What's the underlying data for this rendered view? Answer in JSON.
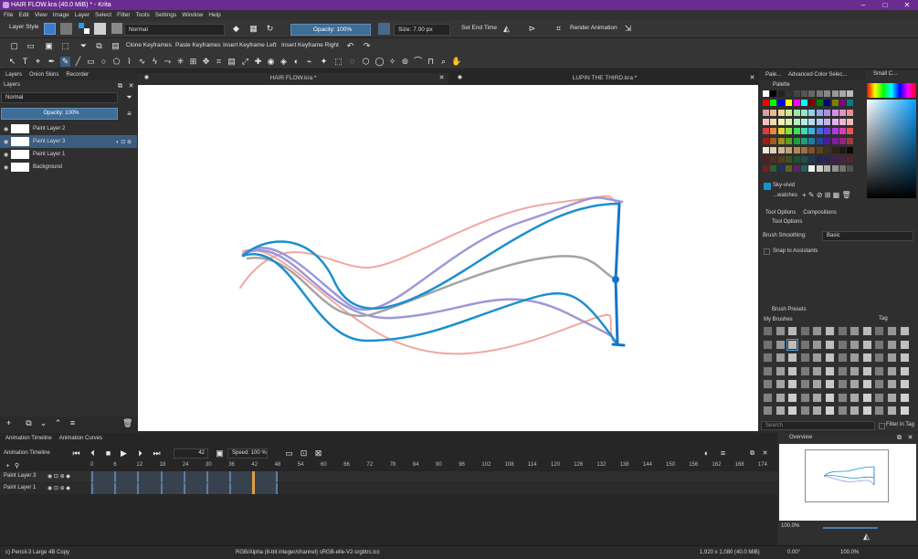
{
  "window": {
    "title": "HAIR FLOW.kra (40.0 MiB)  * - Krita",
    "minimize": "–",
    "maximize": "□",
    "close": "✕"
  },
  "menu": [
    "File",
    "Edit",
    "View",
    "Image",
    "Layer",
    "Select",
    "Filter",
    "Tools",
    "Settings",
    "Window",
    "Help"
  ],
  "toolbar": {
    "layer_style": "Layer Style",
    "blend_mode": "Normal",
    "opacity": "Opacity: 100%",
    "size": "Size: 7.00 px",
    "set_end_time": "Set End Time",
    "render_animation": "Render Animation",
    "clone_keyframes": "Clone Keyframes",
    "paste_keyframes": "Paste Keyframes",
    "insert_keyframe_left": "Insert Keyframe Left",
    "insert_keyframe_right": "Insert Keyframe Right"
  },
  "left_dock": {
    "tabs": [
      "Layers",
      "Onion Skins",
      "Recorder"
    ],
    "header": "Layers",
    "blend_mode": "Normal",
    "opacity": "Opacity:  100%",
    "layers": [
      {
        "name": "Paint Layer 2",
        "selected": false
      },
      {
        "name": "Paint Layer 3",
        "selected": true
      },
      {
        "name": "Paint Layer 1",
        "selected": false
      },
      {
        "name": "Background",
        "selected": false
      }
    ]
  },
  "documents": {
    "tabs": [
      "HAIR FLOW.kra *",
      "LUPIN THE THIRD.kra *"
    ]
  },
  "right_dock": {
    "top_tabs": [
      "Pale...",
      "Advanced Color Selec..."
    ],
    "small_color": "Small C...",
    "palette_title": "Palette",
    "selected_color_name": "Sky-vivid",
    "palette_set": "...watches",
    "options_tabs": [
      "Tool Options",
      "Compositions"
    ],
    "tool_options_title": "Tool Options",
    "brush_smoothing_label": "Brush Smoothing:",
    "brush_smoothing_value": "Basic",
    "snap_label": "Snap to Assistants",
    "brush_presets_title": "Brush Presets",
    "brush_preset_group": "My Brushes",
    "tag_label": "Tag",
    "search_placeholder": "Search",
    "filter_in_tag": "Filter in Tag",
    "overview_title": "Overview",
    "zoom": "100.0%",
    "rotation": "0.00°",
    "rotation2": "0.00°",
    "zoom2": "100.0%"
  },
  "timeline": {
    "tabs": [
      "Animation Timeline",
      "Animation Curves"
    ],
    "title": "Animation Timeline",
    "current_frame": "42",
    "speed": "Speed: 100 %",
    "frame_numbers": [
      "0",
      "6",
      "12",
      "18",
      "24",
      "30",
      "36",
      "42",
      "48",
      "54",
      "60",
      "66",
      "72",
      "78",
      "84",
      "90",
      "96",
      "102",
      "108",
      "114",
      "120",
      "126",
      "132",
      "138",
      "144",
      "150",
      "156",
      "162",
      "168",
      "174"
    ],
    "layers": [
      "Paint Layer 3",
      "Paint Layer 1"
    ]
  },
  "status": {
    "brush": "c) Pencil-3 Large 4B Copy",
    "color_info": "RGB/Alpha (8-bit integer/channel)  sRGB-elle-V2-srgbtrc.icc",
    "dimensions": "1,920 x 1,080 (40.0 MiB)"
  },
  "colors": {
    "accent": "#6a2c91",
    "selection": "#3b5d81",
    "canvas": "#ffffff",
    "stroke_blue": "#1a8fd0",
    "stroke_purple": "#9f98d8",
    "stroke_pink": "#f0a8a0",
    "stroke_gray": "#a4a4a4"
  }
}
